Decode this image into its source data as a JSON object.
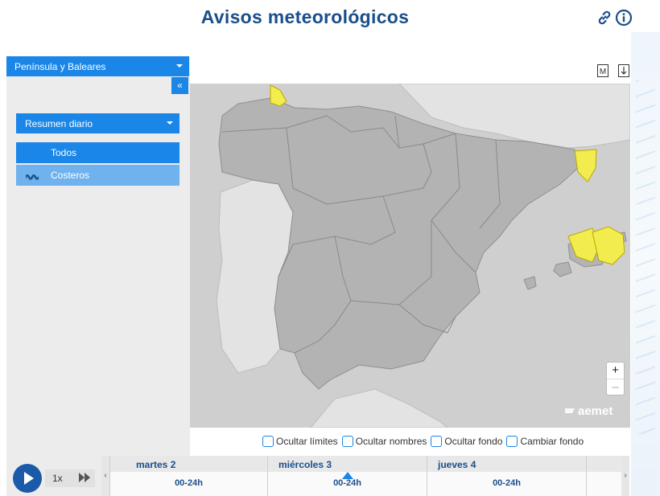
{
  "header": {
    "title": "Avisos meteorológicos",
    "link_icon": "link-icon",
    "info_icon": "info-icon"
  },
  "sidebar": {
    "region_select": "Península y Baleares",
    "collapse_label": "«",
    "summary_select": "Resumen diario",
    "filters": [
      {
        "label": "Todos",
        "icon": ""
      },
      {
        "label": "Costeros",
        "icon": "coastal-waves-icon"
      }
    ]
  },
  "map_tools": {
    "m_label": "M",
    "download_icon": "download-icon"
  },
  "map": {
    "land_color": "#b3b3b3",
    "warning_color": "#f3ec4e",
    "sea_color": "#cfcfcf",
    "logo_text": "aemet",
    "zoom_in": "+",
    "zoom_out": "–"
  },
  "options": [
    {
      "label": "Ocultar límites",
      "checked": false
    },
    {
      "label": "Ocultar nombres",
      "checked": false
    },
    {
      "label": "Ocultar fondo",
      "checked": false
    },
    {
      "label": "Cambiar fondo",
      "checked": false
    }
  ],
  "timeline": {
    "speed": "1x",
    "prev": "‹",
    "next": "›",
    "days": [
      {
        "name": "martes 2",
        "slot": "00-24h"
      },
      {
        "name": "miércoles 3",
        "slot": "00-24h",
        "selected": true
      },
      {
        "name": "jueves 4",
        "slot": "00-24h"
      }
    ]
  }
}
